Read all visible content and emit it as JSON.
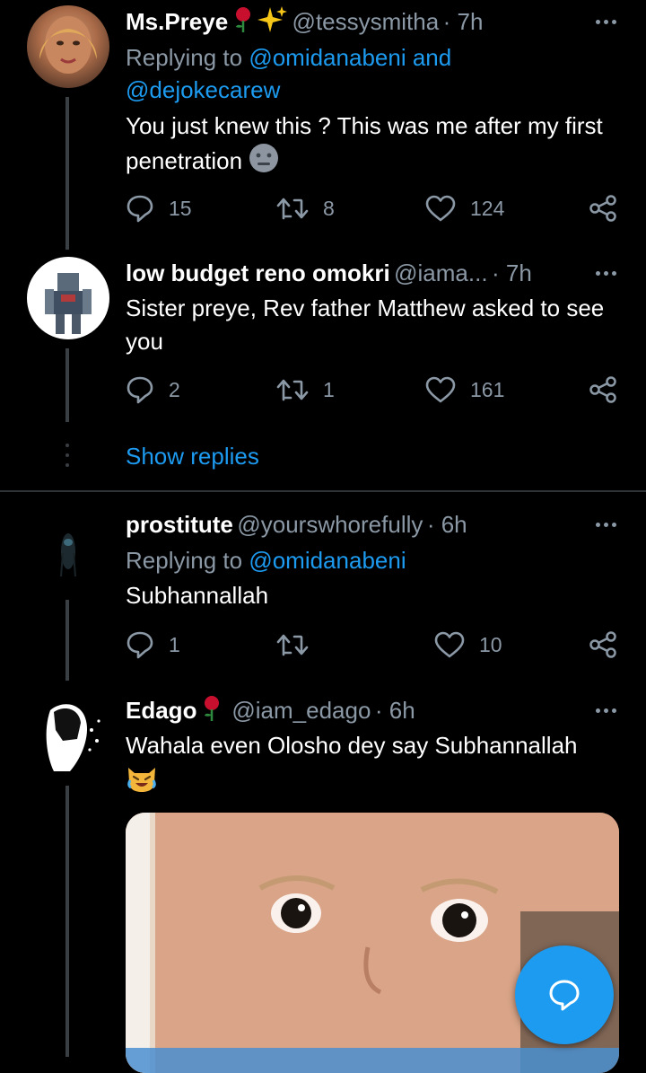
{
  "tweets": [
    {
      "name": "Ms.Preye",
      "handle": "@tessysmitha",
      "time": "· 7h",
      "replying_prefix": "Replying to ",
      "replying_to_1": "@omidanabeni",
      "replying_and": " and",
      "replying_to_2": "@dejokecarew",
      "text": "You just knew this ? This was me after my first penetration",
      "replies": "15",
      "retweets": "8",
      "likes": "124"
    },
    {
      "name": "low budget reno omokri",
      "handle": "@iama...",
      "time": "· 7h",
      "text": "Sister preye, Rev father Matthew asked to see you",
      "replies": "2",
      "retweets": "1",
      "likes": "161",
      "show_replies": "Show replies"
    },
    {
      "name": "prostitute",
      "handle": "@yourswhorefully",
      "time": "· 6h",
      "replying_prefix": "Replying to ",
      "replying_to_1": "@omidanabeni",
      "text": "Subhannallah",
      "replies": "1",
      "retweets": "",
      "likes": "10"
    },
    {
      "name": "Edago",
      "handle": "@iam_edago",
      "time": "· 6h",
      "text": "Wahala even Olosho dey say Subhannallah"
    }
  ],
  "icons": {
    "reply": "reply-icon",
    "retweet": "retweet-icon",
    "like": "heart-icon",
    "share": "share-icon",
    "more": "more-icon",
    "compose": "compose-reply-icon"
  },
  "colors": {
    "background": "#000000",
    "accent": "#1d9bf0",
    "secondary_text": "#8b98a5"
  }
}
